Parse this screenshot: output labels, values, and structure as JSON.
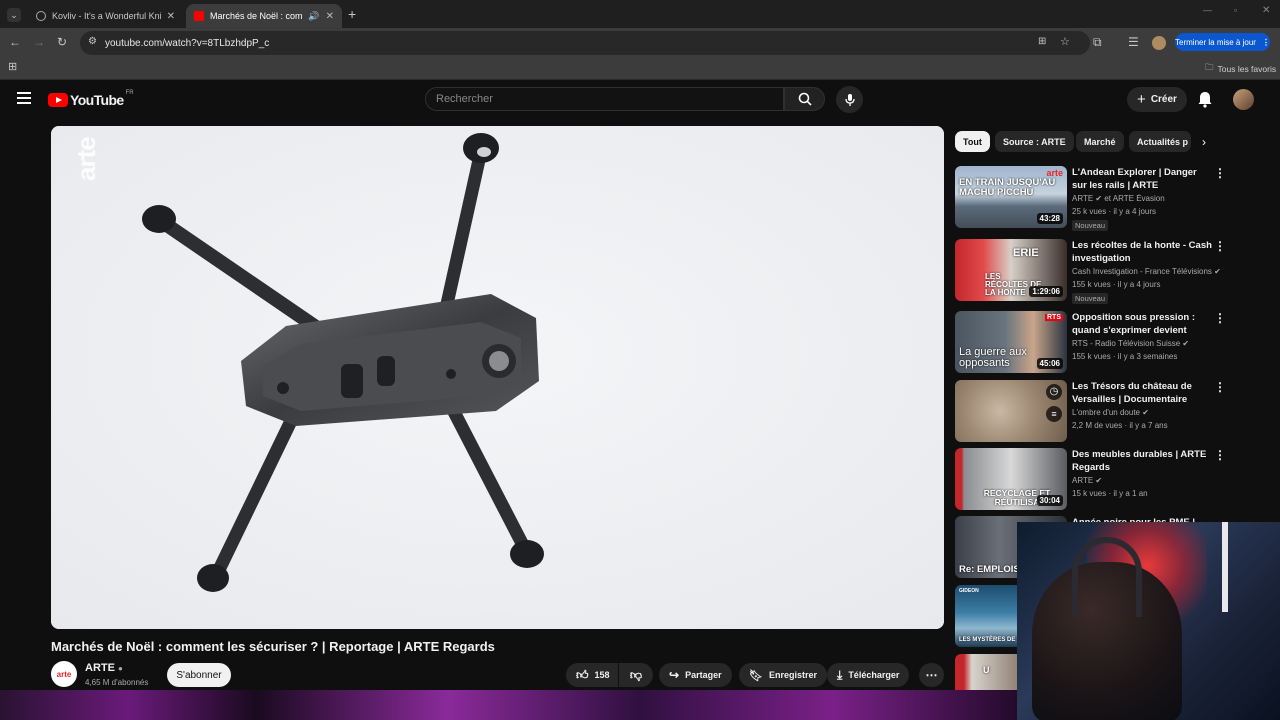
{
  "browser": {
    "tabs": [
      {
        "title": "Kovliv - It's a Wonderful Knife [",
        "active": false
      },
      {
        "title": "Marchés de Noël : comme",
        "active": true
      }
    ],
    "url": "youtube.com/watch?v=8TLbzhdpP_c",
    "update_button": "Terminer la mise à jour",
    "bookmarks_label": "Tous les favoris"
  },
  "youtube": {
    "logo_text": "YouTube",
    "logo_region": "FR",
    "search_placeholder": "Rechercher",
    "create_label": "Créer"
  },
  "video": {
    "title": "Marchés de Noël : comment les sécuriser ? | Reportage | ARTE Regards",
    "watermark": "arte",
    "channel": {
      "name": "ARTE",
      "subscribers": "4,65 M d'abonnés",
      "avatar_text": "arte"
    },
    "subscribe_label": "S'abonner",
    "likes": "158",
    "share_label": "Partager",
    "save_label": "Enregistrer",
    "download_label": "Télécharger"
  },
  "chips": [
    "Tout",
    "Source : ARTE",
    "Marché",
    "Actualités p"
  ],
  "recommendations": [
    {
      "title": "L'Andean Explorer | Danger sur les rails | ARTE",
      "channel": "ARTE ✔ et ARTE Évasion",
      "meta": "25 k vues · il y a 4 jours",
      "badge": "Nouveau",
      "duration": "43:28",
      "thumb_text": "EN TRAIN JUSQU'AU MACHU PICCHU",
      "thumb_logo": "arte"
    },
    {
      "title": "Les récoltes de la honte - Cash investigation",
      "channel": "Cash Investigation - France Télévisions ✔",
      "meta": "155 k vues · il y a 4 jours",
      "badge": "Nouveau",
      "duration": "1:29:06",
      "thumb_text": "LES RÉCOLTES DE LA HONTE",
      "thumb_logo": "ERIE"
    },
    {
      "title": "Opposition sous pression : quand s'exprimer devient risqu...",
      "channel": "RTS - Radio Télévision Suisse ✔",
      "meta": "155 k vues · il y a 3 semaines",
      "badge": "",
      "duration": "45:06",
      "thumb_text": "La guerre aux opposants",
      "thumb_logo": "RTS"
    },
    {
      "title": "Les Trésors du château de Versailles | Documentaire",
      "channel": "L'ombre d'un doute ✔",
      "meta": "2,2 M de vues · il y a 7 ans",
      "badge": "",
      "duration": "",
      "thumb_text": "",
      "thumb_logo": ""
    },
    {
      "title": "Des meubles durables | ARTE Regards",
      "channel": "ARTE ✔",
      "meta": "15 k vues · il y a 1 an",
      "badge": "",
      "duration": "30:04",
      "thumb_text": "RECYCLAGE ET RÉUTILISA",
      "thumb_logo": ""
    },
    {
      "title": "Année noire pour les PME |",
      "channel": "",
      "meta": "",
      "badge": "",
      "duration": "",
      "thumb_text": "Re: EMPLOIS ME",
      "thumb_logo": ""
    },
    {
      "title": "",
      "channel": "",
      "meta": "",
      "badge": "",
      "duration": "",
      "thumb_text": "LES MYSTÈRES DE",
      "thumb_logo": "GIDEON"
    },
    {
      "title": "",
      "channel": "",
      "meta": "",
      "badge": "",
      "duration": "",
      "thumb_text": "U",
      "thumb_logo": ""
    }
  ],
  "colors": {
    "bg": "#0f0f0f",
    "youtube_red": "#ff0000",
    "accent_blue": "#0b57d0",
    "arte_red": "#e8262c"
  }
}
